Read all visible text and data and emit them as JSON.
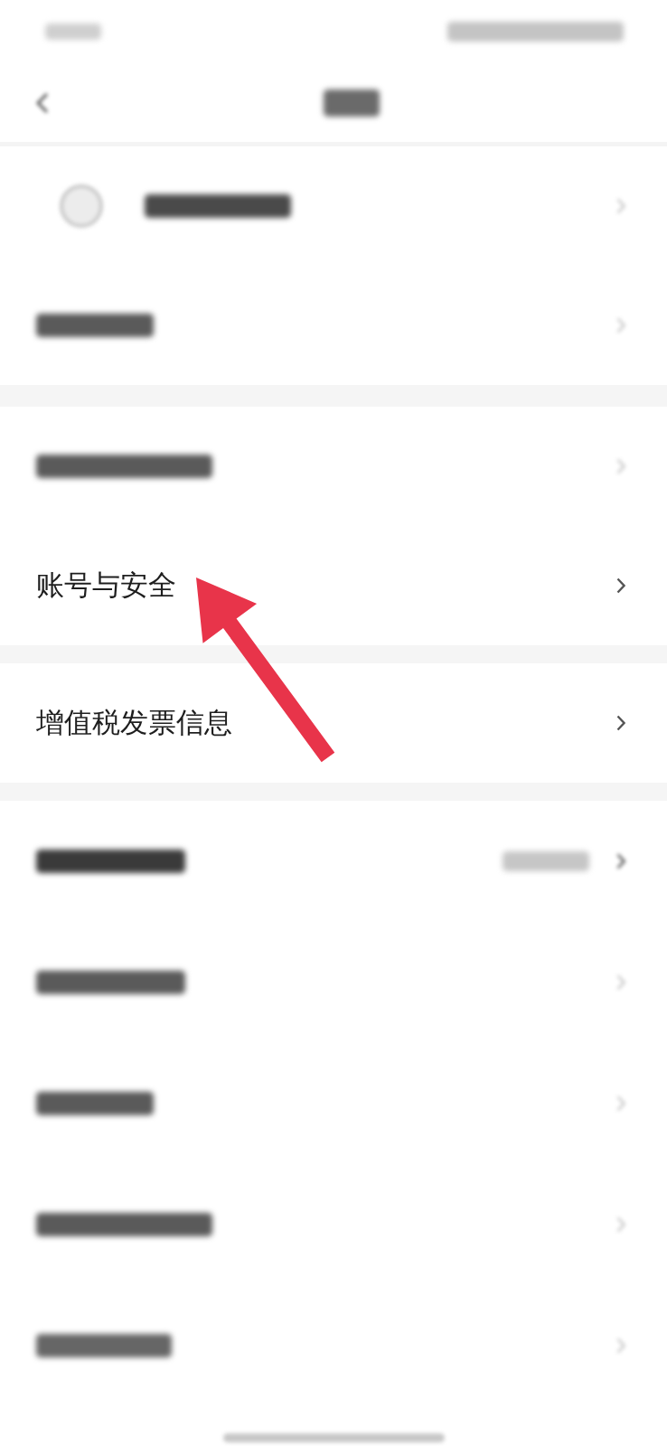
{
  "status_bar": {
    "blurred": true
  },
  "header": {
    "title_blurred": true
  },
  "sections": [
    {
      "rows": [
        {
          "kind": "profile",
          "label_blurred": true,
          "value_blurred": false,
          "pointed_at": false
        },
        {
          "kind": "link",
          "label_blurred": true,
          "value_blurred": false,
          "pointed_at": false
        }
      ]
    },
    {
      "rows": [
        {
          "kind": "link",
          "label_blurred": true,
          "value_blurred": false,
          "pointed_at": false
        },
        {
          "kind": "link",
          "label": "账号与安全",
          "label_blurred": false,
          "value_blurred": false,
          "pointed_at": true
        }
      ]
    },
    {
      "rows": [
        {
          "kind": "link",
          "label": "增值税发票信息",
          "label_blurred": false,
          "value_blurred": false,
          "pointed_at": false
        }
      ]
    },
    {
      "rows": [
        {
          "kind": "link",
          "label_blurred": true,
          "value_blurred": true,
          "pointed_at": false
        },
        {
          "kind": "link",
          "label_blurred": true,
          "value_blurred": false,
          "pointed_at": false
        },
        {
          "kind": "link",
          "label_blurred": true,
          "value_blurred": false,
          "pointed_at": false
        },
        {
          "kind": "link",
          "label_blurred": true,
          "value_blurred": false,
          "pointed_at": false
        },
        {
          "kind": "link",
          "label_blurred": true,
          "value_blurred": false,
          "pointed_at": false
        }
      ]
    }
  ]
}
